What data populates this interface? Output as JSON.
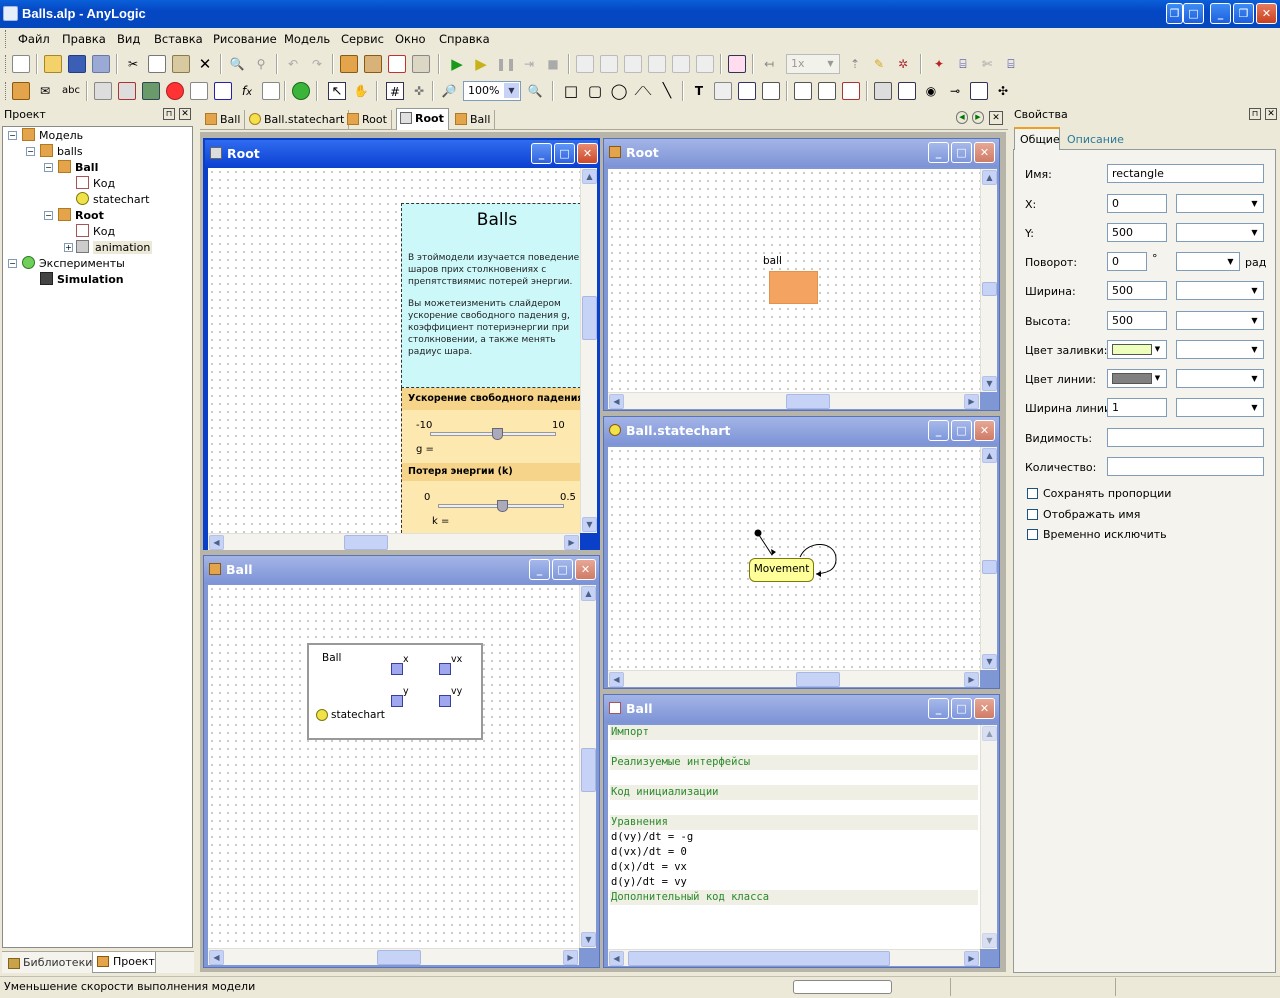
{
  "window": {
    "title": "Balls.alp - AnyLogic"
  },
  "menu": [
    "Файл",
    "Правка",
    "Вид",
    "Вставка",
    "Рисование",
    "Модель",
    "Сервис",
    "Окно",
    "Справка"
  ],
  "toolbar": {
    "zoom": "100%",
    "speed": "1x",
    "text_tool": "abc"
  },
  "project_panel": {
    "title": "Проект",
    "tree": [
      {
        "label": "Модель",
        "level": 0,
        "icon": "model-icon",
        "bold": false
      },
      {
        "label": "balls",
        "level": 1,
        "icon": "package-icon",
        "bold": false
      },
      {
        "label": "Ball",
        "level": 2,
        "icon": "class-icon",
        "bold": true
      },
      {
        "label": "Код",
        "level": 3,
        "icon": "code-icon",
        "bold": false
      },
      {
        "label": "statechart",
        "level": 3,
        "icon": "statechart-icon",
        "bold": false
      },
      {
        "label": "Root",
        "level": 2,
        "icon": "class-icon",
        "bold": true
      },
      {
        "label": "Код",
        "level": 3,
        "icon": "code-icon",
        "bold": false
      },
      {
        "label": "animation",
        "level": 3,
        "icon": "animation-icon",
        "bold": false
      },
      {
        "label": "Эксперименты",
        "level": 0,
        "icon": "experiments-icon",
        "bold": false
      },
      {
        "label": "Simulation",
        "level": 1,
        "icon": "simulation-icon",
        "bold": true
      }
    ],
    "bottom_tabs": [
      "Библиотеки",
      "Проект"
    ]
  },
  "doc_tabs": [
    "Ball",
    "Ball.statechart",
    "Root",
    "Root",
    "Ball"
  ],
  "win_root_main": {
    "title": "Root",
    "balls_title": "Balls",
    "desc1": "В этоймодели изучается поведение шаров прих столкновениях с препятствиямис потерей энергии.",
    "desc2": "Вы можетеизменить слайдером ускорение свободного падения g, коэффициент потериэнергии при столкновении, а также менять радиус шара.",
    "slider1_label": "Ускорение свободного падения  (",
    "slider1_min": "-10",
    "slider1_max": "10",
    "slider1_value": "g =",
    "slider1_pos": 0.52,
    "slider2_label": "Потеря энергии (k)",
    "slider2_min": "0",
    "slider2_max": "0.5",
    "slider2_value": "k =",
    "slider2_pos": 0.5
  },
  "win_ball_struct": {
    "title": "Ball",
    "box_label": "Ball",
    "ports": [
      "x",
      "vx",
      "y",
      "vy"
    ],
    "statechart_label": "statechart"
  },
  "win_root_anim": {
    "title": "Root",
    "shape_label": "ball",
    "shape_color": "#f4a460"
  },
  "win_statechart": {
    "title": "Ball.statechart",
    "state_label": "Movement"
  },
  "win_code": {
    "title": "Ball",
    "lines": [
      {
        "text": "Импорт",
        "kind": "hdr"
      },
      {
        "text": "",
        "kind": "blank"
      },
      {
        "text": "Реализуемые интерфейсы",
        "kind": "hdr"
      },
      {
        "text": "",
        "kind": "blank"
      },
      {
        "text": "Код инициализации",
        "kind": "hdr"
      },
      {
        "text": "",
        "kind": "blank"
      },
      {
        "text": "Уравнения",
        "kind": "hdr"
      },
      {
        "text": "d(vy)/dt = -g",
        "kind": "code"
      },
      {
        "text": "d(vx)/dt = 0",
        "kind": "code"
      },
      {
        "text": "d(x)/dt = vx",
        "kind": "code"
      },
      {
        "text": "d(y)/dt = vy",
        "kind": "code"
      },
      {
        "text": "Дополнительный код класса",
        "kind": "hdr"
      }
    ]
  },
  "properties": {
    "title": "Свойства",
    "tabs": [
      "Общие",
      "Описание"
    ],
    "name_label": "Имя:",
    "name_value": "rectangle",
    "x_label": "X:",
    "x_value": "0",
    "y_label": "Y:",
    "y_value": "500",
    "rot_label": "Поворот:",
    "rot_value": "0",
    "rot_unit1": "°",
    "rot_unit2": "рад",
    "width_label": "Ширина:",
    "width_value": "500",
    "height_label": "Высота:",
    "height_value": "500",
    "fill_label": "Цвет заливки:",
    "fill_color": "#eeffbb",
    "line_color_label": "Цвет линии:",
    "line_color": "#808080",
    "line_width_label": "Ширина линии:",
    "line_width_value": "1",
    "visibility_label": "Видимость:",
    "count_label": "Количество:",
    "cb1": "Сохранять пропорции",
    "cb2": "Отображать имя",
    "cb3": "Временно исключить"
  },
  "status": {
    "text": "Уменьшение скорости выполнения модели"
  }
}
